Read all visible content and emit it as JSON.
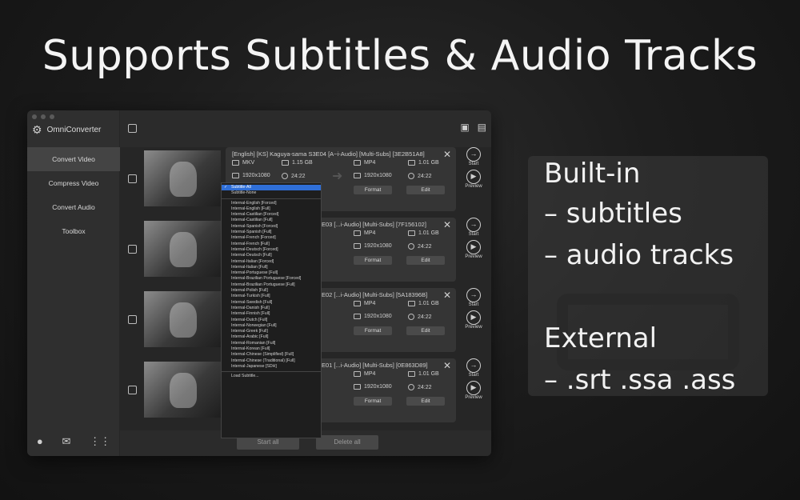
{
  "headline": "Supports Subtitles & Audio Tracks",
  "app": {
    "name": "OmniConverter",
    "nav": [
      "Convert Video",
      "Compress Video",
      "Convert Audio",
      "Toolbox"
    ],
    "bottom_buttons": {
      "start_all": "Start all",
      "delete_all": "Delete all"
    }
  },
  "rows": [
    {
      "title": "[English] [KS] Kaguya-sama S3E04 [A~i-Audio] [Multi-Subs] [3E2B51A8]",
      "src_format": "MKV",
      "src_size": "1.15 GB",
      "src_res": "1920x1080",
      "src_dur": "24:22",
      "out_format": "MP4",
      "out_size": "1.01 GB",
      "out_res": "1920x1080",
      "out_dur": "24:22",
      "format_btn": "Format",
      "edit_btn": "Edit"
    },
    {
      "title": "E03 [...i-Audio] [Multi-Subs] [7F156102]",
      "out_format": "MP4",
      "out_size": "1.01 GB",
      "out_res": "1920x1080",
      "out_dur": "24:22",
      "format_btn": "Format",
      "edit_btn": "Edit"
    },
    {
      "title": "E02 [...i-Audio] [Multi-Subs] [5A18396B]",
      "out_format": "MP4",
      "out_size": "1.01 GB",
      "out_res": "1920x1080",
      "out_dur": "24:22",
      "format_btn": "Format",
      "edit_btn": "Edit"
    },
    {
      "title": "E01 [...i-Audio] [Multi-Subs] [0E863D89]",
      "out_format": "MP4",
      "out_size": "1.01 GB",
      "out_res": "1920x1080",
      "out_dur": "24:22",
      "format_btn": "Format",
      "edit_btn": "Edit"
    }
  ],
  "row_actions": {
    "start": "Start",
    "preview": "Preview"
  },
  "dropdown": {
    "selected": "Subtitle-All",
    "none": "Subtitle-None",
    "items": [
      "Internal-English [Forced]",
      "Internal-English [Full]",
      "Internal-Castilian [Forced]",
      "Internal-Castilian [Full]",
      "Internal-Spanish [Forced]",
      "Internal-Spanish [Full]",
      "Internal-French [Forced]",
      "Internal-French [Full]",
      "Internal-Deutsch [Forced]",
      "Internal-Deutsch [Full]",
      "Internal-Italian [Forced]",
      "Internal-Italian [Full]",
      "Internal-Portuguese [Full]",
      "Internal-Brazilian Portuguese [Forced]",
      "Internal-Brazilian Portuguese [Full]",
      "Internal-Polish [Full]",
      "Internal-Turkish [Full]",
      "Internal-Swedish [Full]",
      "Internal-Danish [Full]",
      "Internal-Finnish [Full]",
      "Internal-Dutch [Full]",
      "Internal-Norwegian [Full]",
      "Internal-Greek [Full]",
      "Internal-Arabic [Full]",
      "Internal-Romanian [Full]",
      "Internal-Korean [Full]",
      "Internal-Chinese (Simplified) [Full]",
      "Internal-Chinese (Traditional) [Full]",
      "Internal-Japanese [SDH]"
    ],
    "load": "Load Subtitle..."
  },
  "info_panel": {
    "lines": [
      "Built-in",
      "– subtitles",
      "– audio tracks",
      "External",
      "– .srt .ssa .ass"
    ]
  }
}
